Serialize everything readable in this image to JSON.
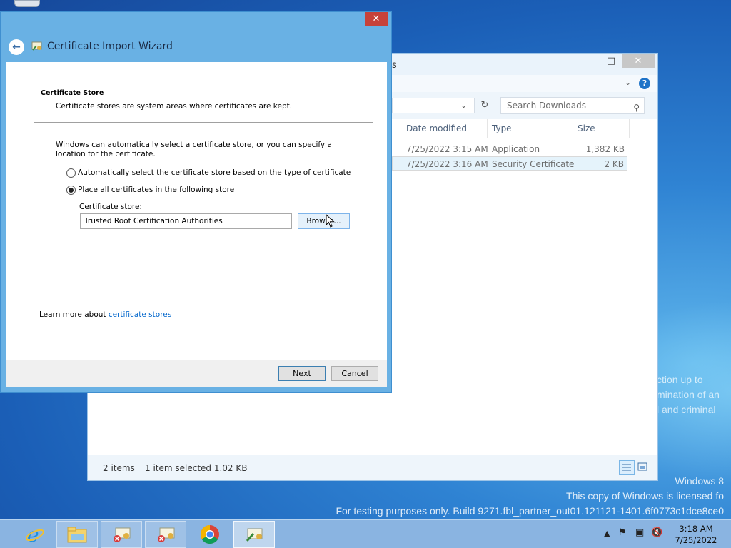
{
  "wizard": {
    "title": "Certificate Import Wizard",
    "close": "✕",
    "section_title": "Certificate Store",
    "section_subtitle": "Certificate stores are system areas where certificates are kept.",
    "intro": "Windows can automatically select a certificate store, or you can specify a location for the certificate.",
    "radio_auto": "Automatically select the certificate store based on the type of certificate",
    "radio_manual": "Place all certificates in the following store",
    "radio_auto_checked": false,
    "radio_manual_checked": true,
    "store_label": "Certificate store:",
    "store_value": "Trusted Root Certification Authorities",
    "browse_label": "Browse...",
    "learn_prefix": "Learn more about ",
    "learn_link": "certificate stores",
    "next_label": "Next",
    "cancel_label": "Cancel"
  },
  "explorer": {
    "title_fragment": "s",
    "search_placeholder": "Search Downloads",
    "columns": [
      "Date modified",
      "Type",
      "Size"
    ],
    "rows": [
      {
        "date": "7/25/2022 3:15 AM",
        "type": "Application",
        "size": "1,382 KB",
        "selected": false
      },
      {
        "date": "7/25/2022 3:16 AM",
        "type": "Security Certificate",
        "size": "2 KB",
        "selected": true
      }
    ],
    "status_items": "2 items",
    "status_selected": "1 item selected  1.02 KB"
  },
  "desktop": {
    "watermark_line1": "Windows 8",
    "watermark_line2": "This copy of Windows is licensed fo",
    "watermark_line3": "For testing purposes only. Build 9271.fbl_partner_out01.121121-1401.6f0773c1dce8ce0",
    "bg_text1": "ction up to",
    "bg_text2": "mination of an",
    "bg_text3": "l and criminal"
  },
  "taskbar": {
    "apps": [
      "internet-explorer",
      "file-explorer",
      "certificate-error",
      "certificate-error",
      "chrome",
      "certificate-wizard"
    ],
    "time": "3:18 AM",
    "date": "7/25/2022"
  },
  "colors": {
    "wizard_frame": "#69b1e4",
    "link": "#0066cc",
    "close_red": "#c7423a"
  }
}
